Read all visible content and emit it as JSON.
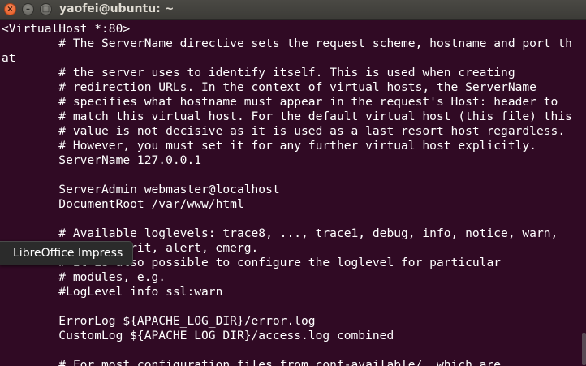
{
  "window": {
    "title": "yaofei@ubuntu: ~",
    "close_glyph": "×",
    "minimize_glyph": "–",
    "maximize_glyph": "□"
  },
  "terminal": {
    "lines": [
      "<VirtualHost *:80>",
      "        # The ServerName directive sets the request scheme, hostname and port th",
      "at",
      "        # the server uses to identify itself. This is used when creating",
      "        # redirection URLs. In the context of virtual hosts, the ServerName",
      "        # specifies what hostname must appear in the request's Host: header to",
      "        # match this virtual host. For the default virtual host (this file) this",
      "        # value is not decisive as it is used as a last resort host regardless.",
      "        # However, you must set it for any further virtual host explicitly.",
      "        ServerName 127.0.0.1",
      "",
      "        ServerAdmin webmaster@localhost",
      "        DocumentRoot /var/www/html",
      "",
      "        # Available loglevels: trace8, ..., trace1, debug, info, notice, warn,",
      "        # error, crit, alert, emerg.",
      "        # It is also possible to configure the loglevel for particular",
      "        # modules, e.g.",
      "        #LogLevel info ssl:warn",
      "",
      "        ErrorLog ${APACHE_LOG_DIR}/error.log",
      "        CustomLog ${APACHE_LOG_DIR}/access.log combined",
      "",
      "        # For most configuration files from conf-available/, which are"
    ]
  },
  "tooltip": {
    "label": "LibreOffice Impress"
  },
  "colors": {
    "terminal_bg": "#300a24",
    "terminal_fg": "#ffffff",
    "titlebar_bg": "#3c3b37",
    "close_button": "#e2571e"
  }
}
